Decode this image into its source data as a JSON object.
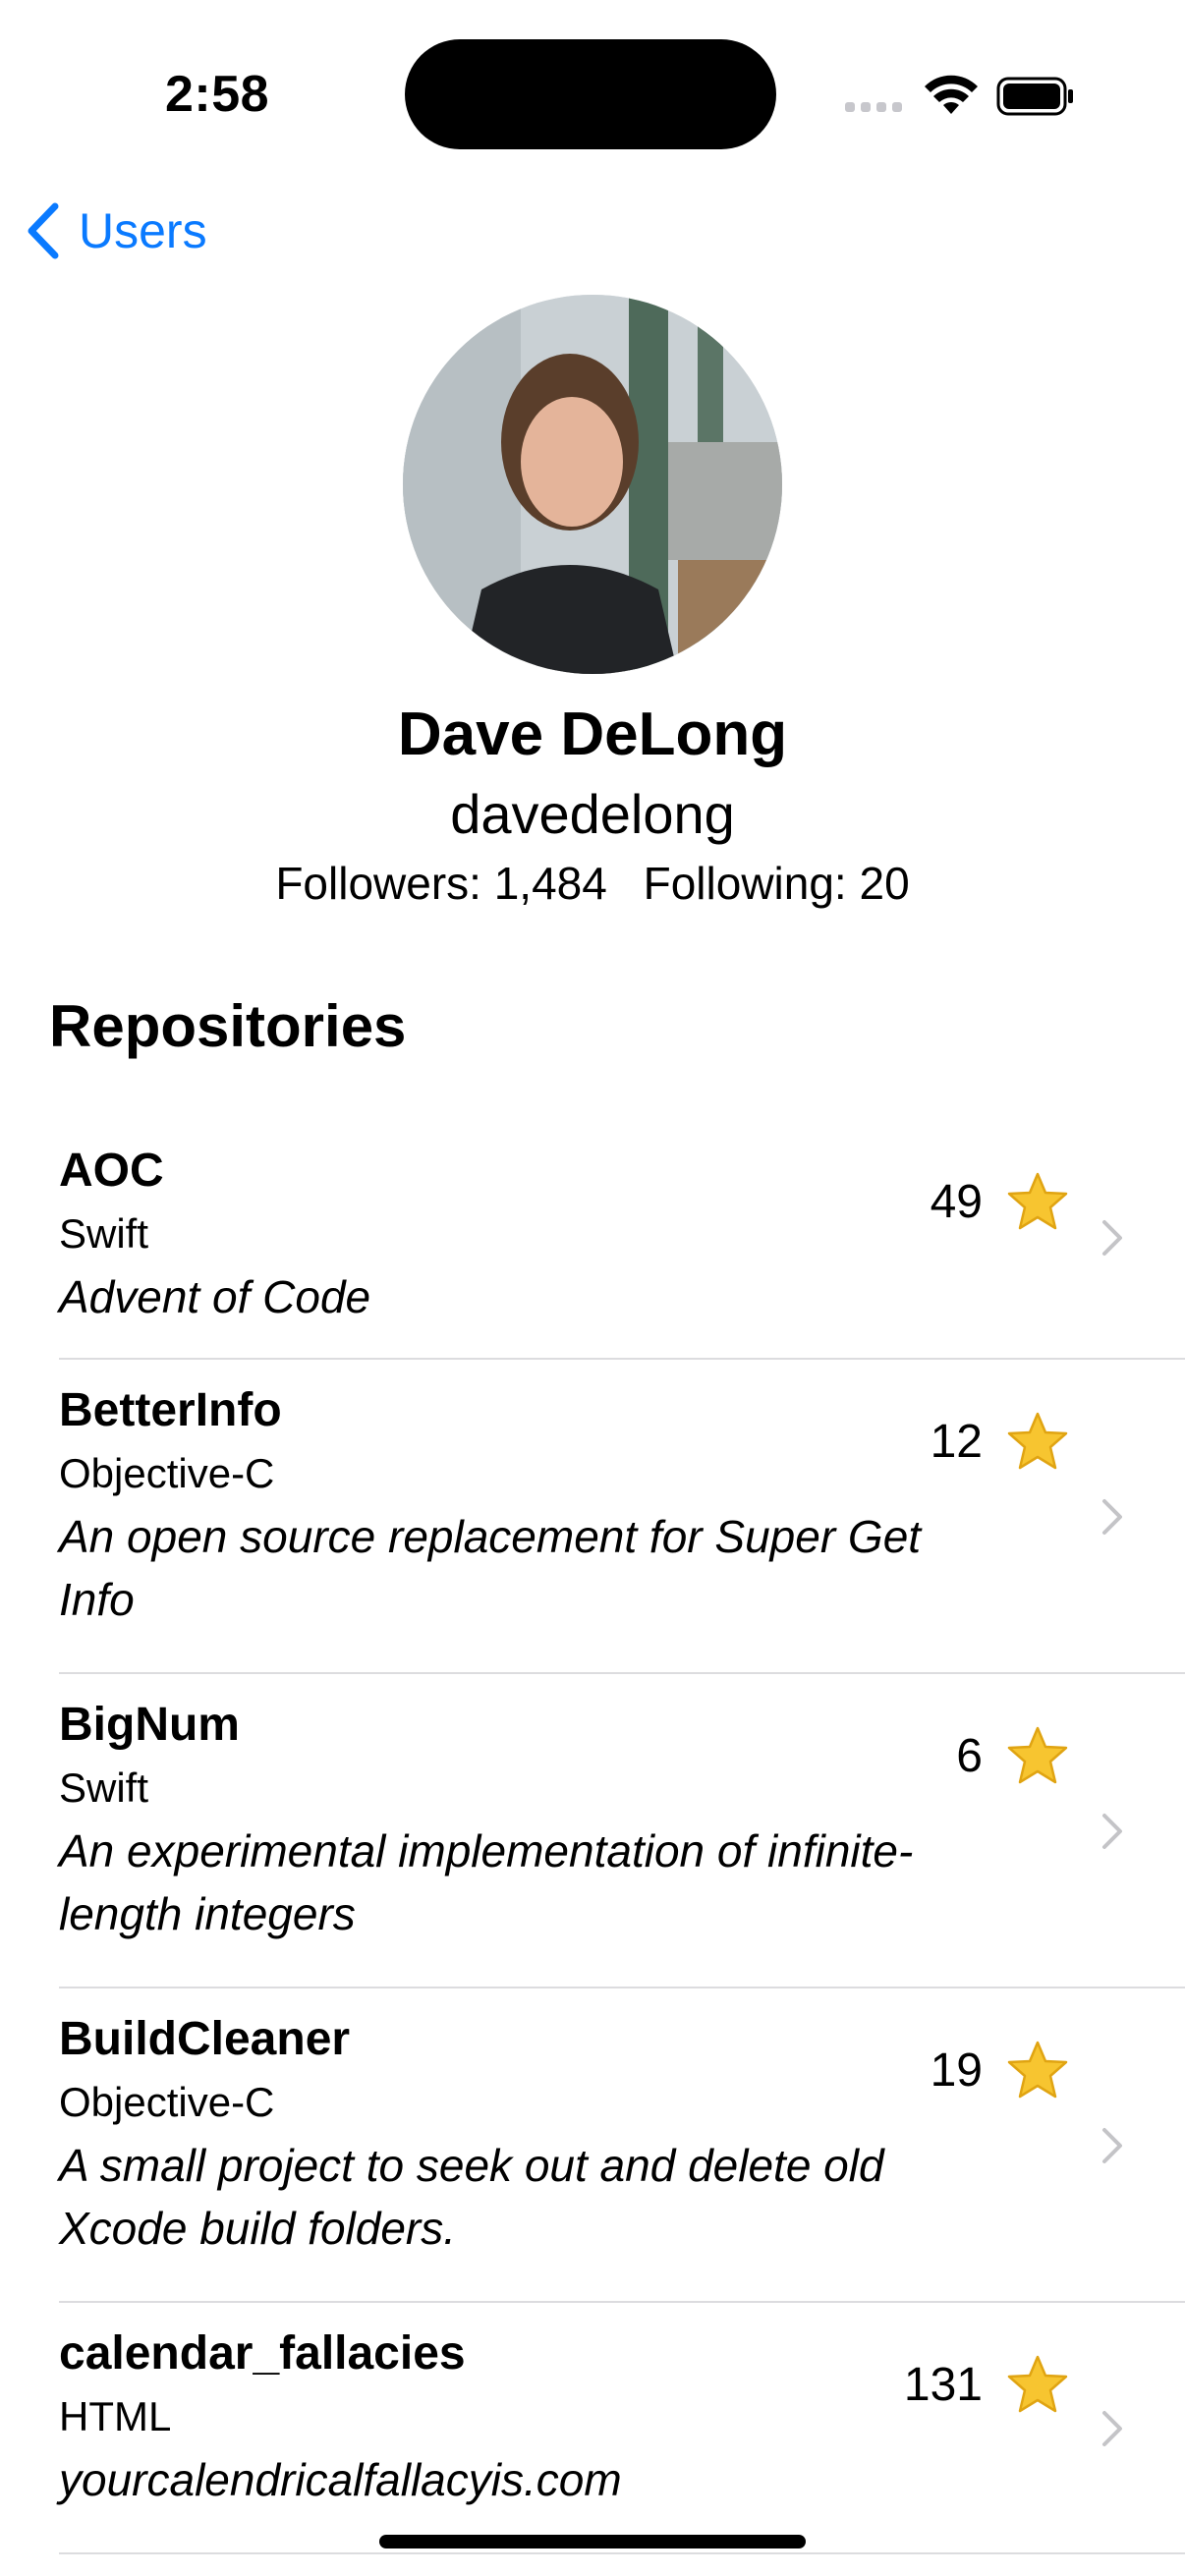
{
  "status_bar": {
    "time": "2:58"
  },
  "nav": {
    "back_label": "Users"
  },
  "profile": {
    "name": "Dave DeLong",
    "username": "davedelong",
    "followers": "Followers: 1,484",
    "following": "Following: 20"
  },
  "section_title": "Repositories",
  "repos": [
    {
      "name": "AOC",
      "language": "Swift",
      "description": "Advent of Code",
      "stars": "49"
    },
    {
      "name": "BetterInfo",
      "language": "Objective-C",
      "description": "An open source replacement for Super Get Info",
      "stars": "12"
    },
    {
      "name": "BigNum",
      "language": "Swift",
      "description": "An experimental implementation of infinite-length integers",
      "stars": "6"
    },
    {
      "name": "BuildCleaner",
      "language": "Objective-C",
      "description": "A small project to seek out and delete old Xcode build folders.",
      "stars": "19"
    },
    {
      "name": "calendar_fallacies",
      "language": "HTML",
      "description": "yourcalendricalfallacyis.com",
      "stars": "131"
    }
  ],
  "colors": {
    "accent": "#0a7aff",
    "star": "#f7c530",
    "divider": "#dcdcdf"
  }
}
